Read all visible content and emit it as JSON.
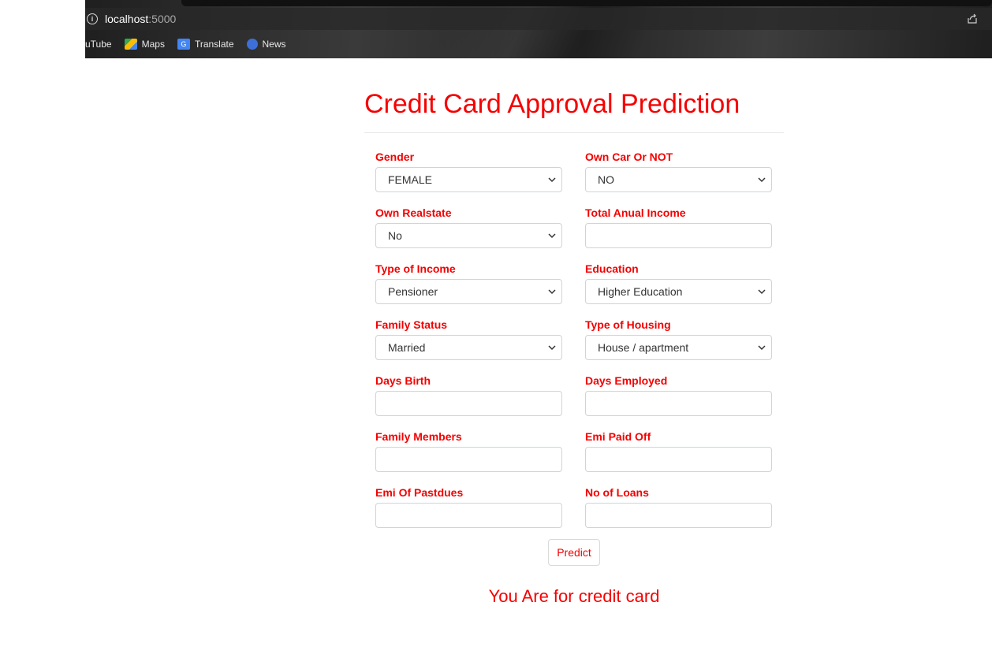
{
  "browser": {
    "url_host": "localhost",
    "url_port": ":5000",
    "bookmarks": [
      {
        "label": "uTube",
        "icon": "none"
      },
      {
        "label": "Maps",
        "icon": "maps-icon"
      },
      {
        "label": "Translate",
        "icon": "translate-icon"
      },
      {
        "label": "News",
        "icon": "news-icon"
      }
    ]
  },
  "page": {
    "title": "Credit Card Approval Prediction",
    "accent_color": "#f50000"
  },
  "form": {
    "gender": {
      "label": "Gender",
      "value": "FEMALE"
    },
    "own_car": {
      "label": "Own Car Or NOT",
      "value": "NO"
    },
    "own_realstate": {
      "label": "Own Realstate",
      "value": "No"
    },
    "total_income": {
      "label": "Total Anual Income",
      "value": ""
    },
    "income_type": {
      "label": "Type of Income",
      "value": "Pensioner"
    },
    "education": {
      "label": "Education",
      "value": "Higher Education"
    },
    "family_status": {
      "label": "Family Status",
      "value": "Married"
    },
    "housing_type": {
      "label": "Type of Housing",
      "value": "House / apartment"
    },
    "days_birth": {
      "label": "Days Birth",
      "value": ""
    },
    "days_employed": {
      "label": "Days Employed",
      "value": ""
    },
    "family_members": {
      "label": "Family Members",
      "value": ""
    },
    "emi_paid_off": {
      "label": "Emi Paid Off",
      "value": ""
    },
    "emi_pastdues": {
      "label": "Emi Of Pastdues",
      "value": ""
    },
    "no_of_loans": {
      "label": "No of Loans",
      "value": ""
    },
    "submit_label": "Predict"
  },
  "result_text": "You Are for credit card"
}
